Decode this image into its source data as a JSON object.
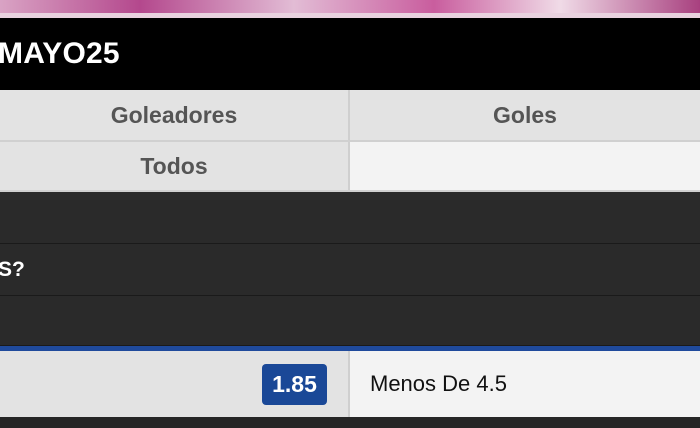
{
  "header": {
    "title": "MAYO25"
  },
  "tabs": {
    "row1": [
      "Goleadores",
      "Goles"
    ],
    "row2": [
      "Todos",
      ""
    ]
  },
  "question": {
    "text": "S?"
  },
  "bet": {
    "odds": "1.85",
    "selection": "Menos De 4.5"
  },
  "colors": {
    "accent_blue": "#1a4897",
    "header_bg": "#000000",
    "dark_row_bg": "#2a2a2a"
  }
}
